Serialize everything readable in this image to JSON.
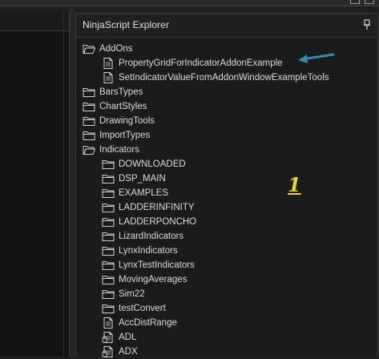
{
  "explorer": {
    "title": "NinjaScript Explorer",
    "items": [
      {
        "label": "AddOns",
        "type": "folder-open",
        "level": 0
      },
      {
        "label": "PropertyGridForIndicatorAddonExample",
        "type": "file",
        "level": 1
      },
      {
        "label": "SetIndicatorValueFromAddonWindowExampleTools",
        "type": "file",
        "level": 1
      },
      {
        "label": "BarsTypes",
        "type": "folder",
        "level": 0
      },
      {
        "label": "ChartStyles",
        "type": "folder",
        "level": 0
      },
      {
        "label": "DrawingTools",
        "type": "folder",
        "level": 0
      },
      {
        "label": "ImportTypes",
        "type": "folder",
        "level": 0
      },
      {
        "label": "Indicators",
        "type": "folder-open",
        "level": 0
      },
      {
        "label": "DOWNLOADED",
        "type": "folder",
        "level": 1
      },
      {
        "label": "DSP_MAIN",
        "type": "folder",
        "level": 1
      },
      {
        "label": "EXAMPLES",
        "type": "folder",
        "level": 1
      },
      {
        "label": "LADDERINFINITY",
        "type": "folder",
        "level": 1
      },
      {
        "label": "LADDERPONCHO",
        "type": "folder",
        "level": 1
      },
      {
        "label": "LizardIndicators",
        "type": "folder",
        "level": 1
      },
      {
        "label": "LynxIndicators",
        "type": "folder",
        "level": 1
      },
      {
        "label": "LynxTestIndicators",
        "type": "folder",
        "level": 1
      },
      {
        "label": "MovingAverages",
        "type": "folder",
        "level": 1
      },
      {
        "label": "Sim22",
        "type": "folder",
        "level": 1
      },
      {
        "label": "testConvert",
        "type": "folder",
        "level": 1
      },
      {
        "label": "AccDistRange",
        "type": "file",
        "level": 1
      },
      {
        "label": "ADL",
        "type": "file-lock",
        "level": 1
      },
      {
        "label": "ADX",
        "type": "file-lock",
        "level": 1
      }
    ]
  },
  "annotation": {
    "marker": "1",
    "arrow_color": "#2f8fa8",
    "marker_color": "#e9d82a"
  },
  "icons": {
    "pin": "pin-icon",
    "folder": "folder-icon",
    "file": "file-icon"
  }
}
